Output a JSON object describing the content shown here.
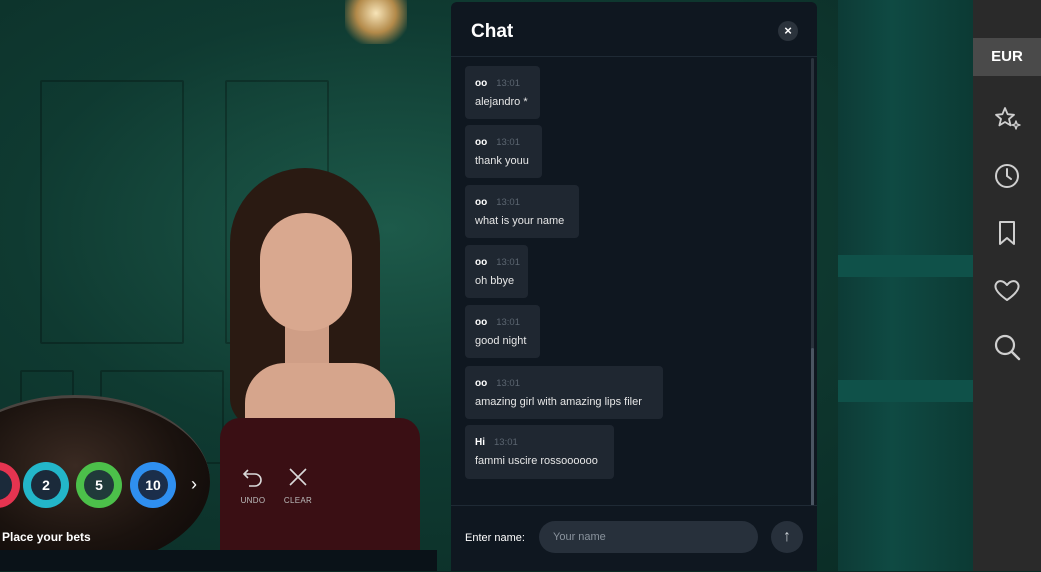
{
  "game": {
    "chips": [
      "2",
      "5",
      "10"
    ],
    "next_glyph": "›",
    "undo_label": "UNDO",
    "clear_label": "CLEAR",
    "status_text": "Place your bets"
  },
  "chat": {
    "title": "Chat",
    "close_glyph": "×",
    "messages": [
      {
        "user": "oo",
        "time": "13:01",
        "text": "alejandro *"
      },
      {
        "user": "oo",
        "time": "13:01",
        "text": "thank youu"
      },
      {
        "user": "oo",
        "time": "13:01",
        "text": "what is your name"
      },
      {
        "user": "oo",
        "time": "13:01",
        "text": "oh bbye"
      },
      {
        "user": "oo",
        "time": "13:01",
        "text": "good night"
      },
      {
        "user": "oo",
        "time": "13:01",
        "text": "amazing girl with amazing lips filer"
      },
      {
        "user": "Hi",
        "time": "13:01",
        "text": "fammi uscire rossoooooo"
      }
    ],
    "footer": {
      "name_label": "Enter name:",
      "name_placeholder": "Your name",
      "send_glyph": "↑"
    }
  },
  "sidebar": {
    "currency": "EUR",
    "icons": [
      "star-sparkle-icon",
      "clock-icon",
      "bookmark-icon",
      "heart-icon",
      "search-icon"
    ]
  },
  "colors": {
    "chat_bg": "#0f1720",
    "bubble_bg": "#1f2731",
    "sidebar_bg": "#2a2a2a",
    "currency_bg": "#4a4a4a",
    "chip_red": "#e53450",
    "chip_teal": "#23b6c9",
    "chip_green": "#4cc04a",
    "chip_blue": "#2f8ff0"
  }
}
